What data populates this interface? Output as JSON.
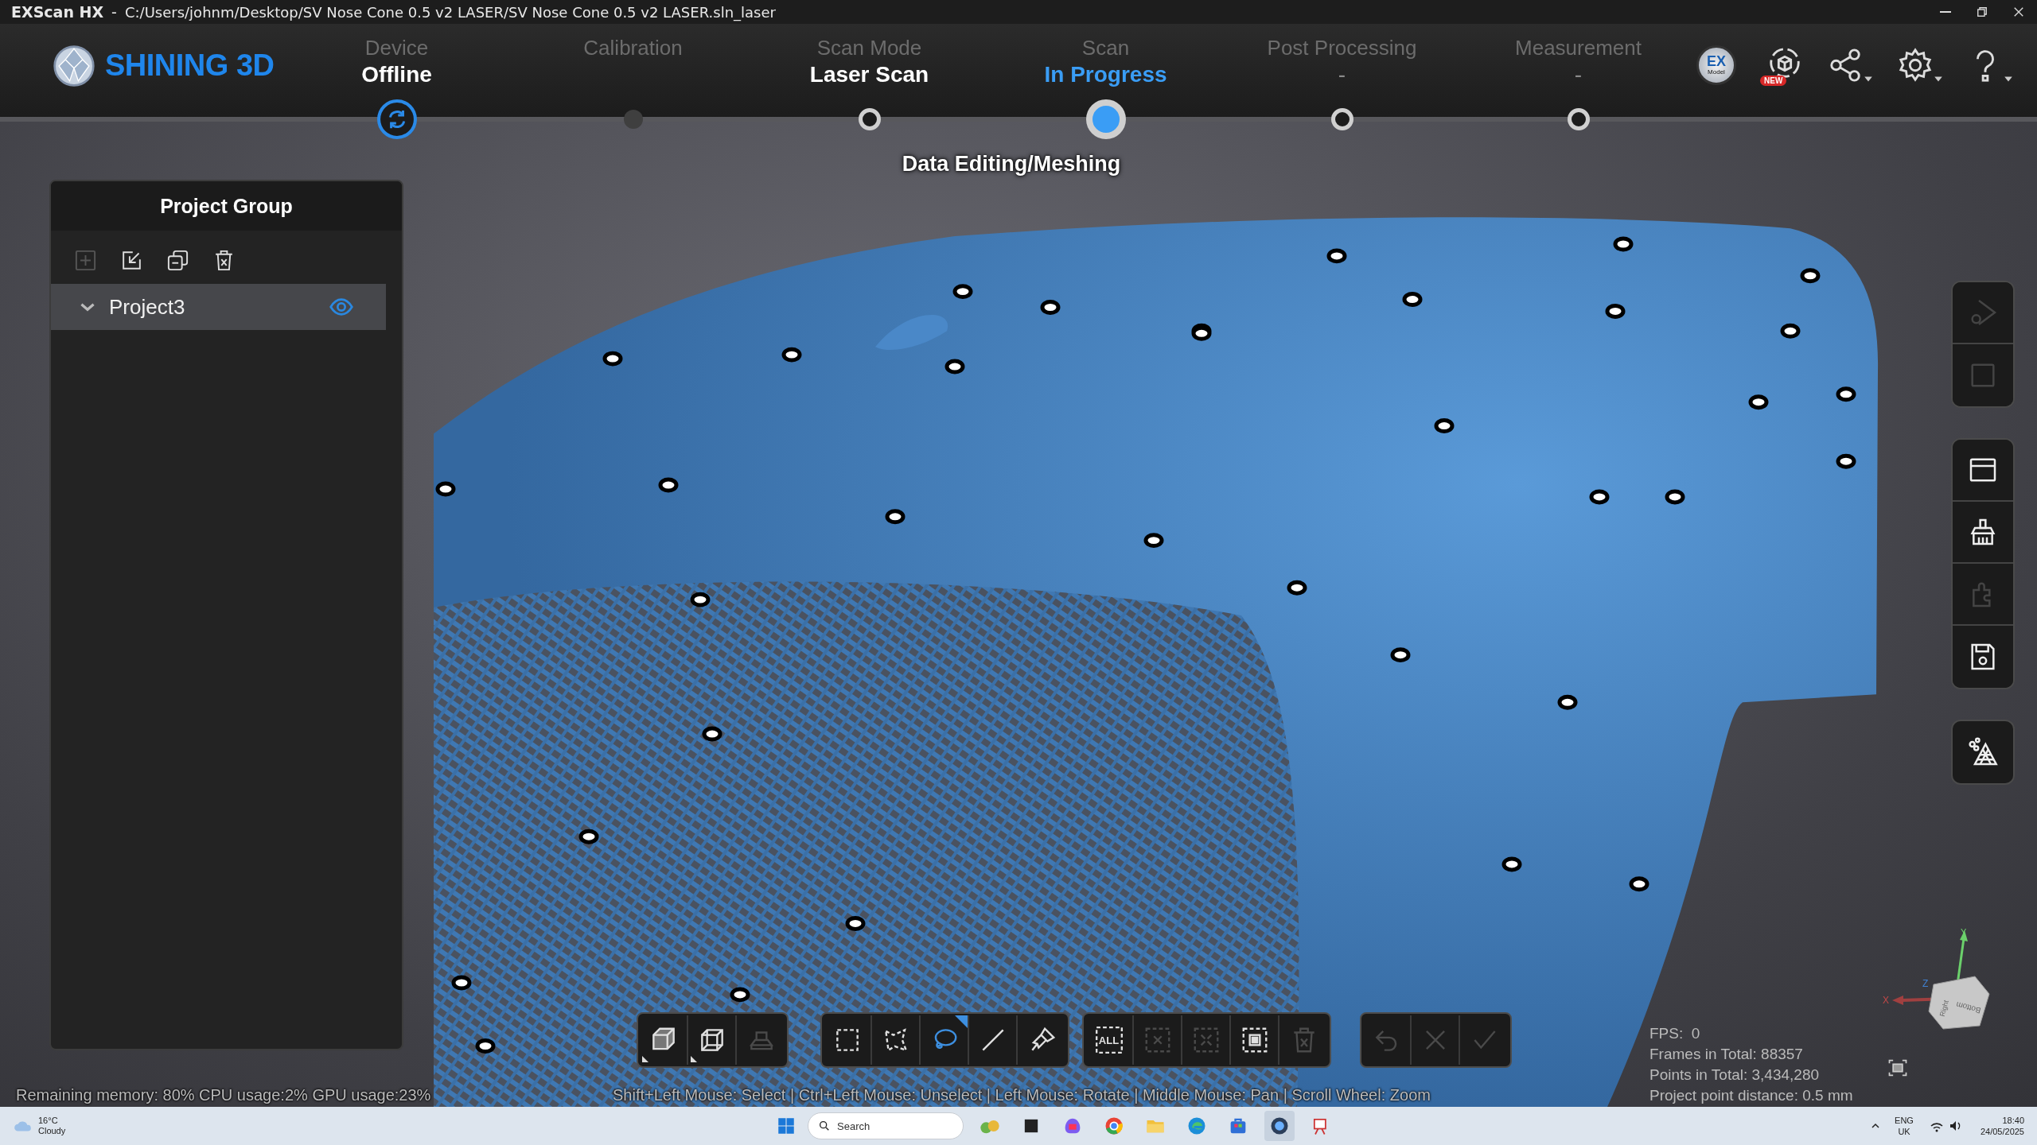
{
  "window": {
    "app_name": "EXScan HX",
    "separator": "-",
    "path": "C:/Users/johnm/Desktop/SV Nose Cone 0.5 v2 LASER/SV Nose Cone 0.5 v2 LASER.sln_laser",
    "controls": [
      {
        "kind": "minimize"
      },
      {
        "kind": "restore"
      },
      {
        "kind": "close"
      }
    ]
  },
  "logo": {
    "text": "SHINING 3D"
  },
  "steps": [
    {
      "label": "Device",
      "value": "Offline",
      "kind": "sync",
      "done": true,
      "selected": false
    },
    {
      "label": "Calibration",
      "kind": "idle",
      "selected": false
    },
    {
      "label": "Scan Mode",
      "value": "Laser Scan",
      "kind": "ring",
      "done": true,
      "selected": false
    },
    {
      "label": "Scan",
      "value": "In Progress",
      "kind": "current",
      "done": false,
      "selected": true
    },
    {
      "label": "Post Processing",
      "value": "-",
      "kind": "ring",
      "done": false,
      "selected": false
    },
    {
      "label": "Measurement",
      "value": "-",
      "kind": "ring",
      "done": false,
      "selected": false
    }
  ],
  "header_tools": [
    {
      "kind": "ex-model",
      "logo": "EX",
      "caption": "Model"
    },
    {
      "kind": "new-device",
      "badge": "NEW"
    },
    {
      "kind": "share",
      "menu": true
    },
    {
      "kind": "gear",
      "menu": true
    },
    {
      "kind": "help",
      "menu": true
    }
  ],
  "stage_label": "Data Editing/Meshing",
  "project_panel": {
    "title": "Project Group",
    "tools": [
      {
        "kind": "add",
        "disabled": true
      },
      {
        "kind": "import",
        "disabled": false
      },
      {
        "kind": "merge",
        "disabled": false
      },
      {
        "kind": "trash",
        "disabled": false
      }
    ],
    "projects": [
      {
        "name": "Project3",
        "expanded": true,
        "visible": true,
        "selected": true
      }
    ]
  },
  "right_toolbar": [
    [
      {
        "kind": "play-gear",
        "disabled": true
      },
      {
        "kind": "stop",
        "disabled": true
      }
    ],
    [
      {
        "kind": "window",
        "disabled": false
      },
      {
        "kind": "brush",
        "disabled": false
      },
      {
        "kind": "puzzle",
        "disabled": true
      },
      {
        "kind": "save",
        "disabled": false
      }
    ],
    [
      {
        "kind": "mesh",
        "disabled": false
      }
    ]
  ],
  "bottom_toolbar": [
    [
      {
        "kind": "box",
        "disabled": false,
        "selected": false,
        "menu": true
      },
      {
        "kind": "cube-wire",
        "disabled": false,
        "selected": false,
        "menu": true
      },
      {
        "kind": "platform",
        "disabled": true,
        "selected": false,
        "menu": false
      }
    ],
    [
      {
        "kind": "rect-select",
        "disabled": false,
        "selected": false,
        "menu": false
      },
      {
        "kind": "poly-select",
        "disabled": false,
        "selected": false,
        "menu": false
      },
      {
        "kind": "lasso",
        "disabled": false,
        "selected": true,
        "menu": false
      },
      {
        "kind": "line",
        "disabled": false,
        "selected": false,
        "menu": false
      },
      {
        "kind": "paint",
        "disabled": false,
        "selected": false,
        "menu": false
      }
    ],
    [
      {
        "kind": "all",
        "label": "ALL",
        "disabled": false,
        "selected": false,
        "menu": false
      },
      {
        "kind": "deselect",
        "disabled": true,
        "selected": false,
        "menu": false
      },
      {
        "kind": "invert",
        "disabled": true,
        "selected": false,
        "menu": false
      },
      {
        "kind": "fit-select",
        "disabled": false,
        "selected": false,
        "menu": false
      },
      {
        "kind": "trash",
        "disabled": true,
        "selected": false,
        "menu": false
      }
    ],
    [
      {
        "kind": "undo",
        "disabled": true,
        "selected": false,
        "menu": false
      },
      {
        "kind": "cancel",
        "disabled": true,
        "selected": false,
        "menu": false
      },
      {
        "kind": "check",
        "disabled": true,
        "selected": false,
        "menu": false
      }
    ]
  ],
  "status": {
    "resources": "Remaining memory: 80% CPU usage:2%  GPU usage:23%",
    "hint": "Shift+Left Mouse: Select | Ctrl+Left Mouse: Unselect | Left Mouse: Rotate | Middle Mouse: Pan | Scroll Wheel: Zoom"
  },
  "stats": [
    "FPS:  0",
    "Frames in Total: 88357",
    "Points in Total: 3,434,280",
    "Project point distance: 0.5 mm"
  ],
  "axis": {
    "x": "X",
    "y": "Y",
    "z": "Z",
    "faces": [
      "Right",
      "Bottom"
    ]
  },
  "taskbar": {
    "weather": {
      "temp": "16°C",
      "desc": "Cloudy"
    },
    "search_placeholder": "Search",
    "apps": [
      {
        "kind": "widgets",
        "selected": false
      },
      {
        "kind": "task-view",
        "selected": false
      },
      {
        "kind": "copilot",
        "selected": false
      },
      {
        "kind": "chrome",
        "selected": false
      },
      {
        "kind": "folder",
        "selected": false
      },
      {
        "kind": "edge",
        "selected": false
      },
      {
        "kind": "store",
        "selected": false
      },
      {
        "kind": "exscan",
        "selected": true
      },
      {
        "kind": "snipping",
        "selected": false
      }
    ],
    "language": "ENG",
    "region": "UK",
    "time": "18:40",
    "date": "24/05/2025"
  }
}
